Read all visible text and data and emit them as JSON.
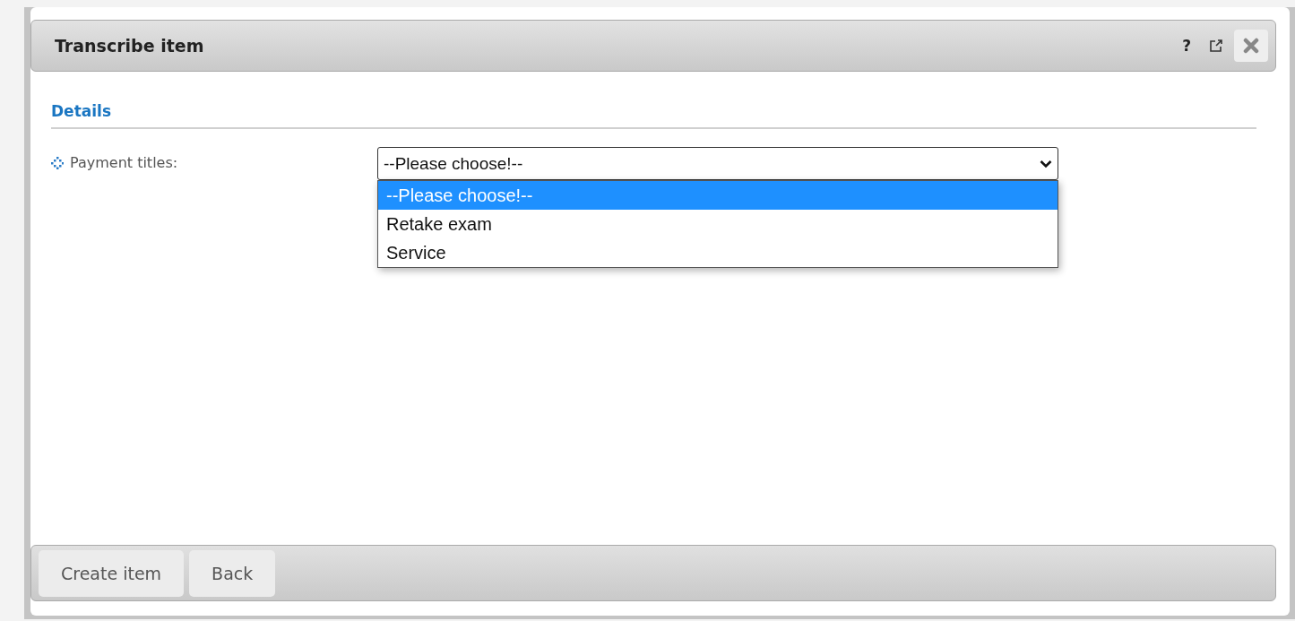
{
  "dialog": {
    "title": "Transcribe item",
    "help": "?"
  },
  "section": {
    "title": "Details"
  },
  "field": {
    "label": "Payment titles:",
    "value": "--Please choose!--",
    "expanded": true,
    "options": [
      {
        "label": "--Please choose!--",
        "selected": true
      },
      {
        "label": "Retake exam",
        "selected": false
      },
      {
        "label": "Service",
        "selected": false
      }
    ]
  },
  "buttons": [
    "Create item",
    "Back"
  ]
}
